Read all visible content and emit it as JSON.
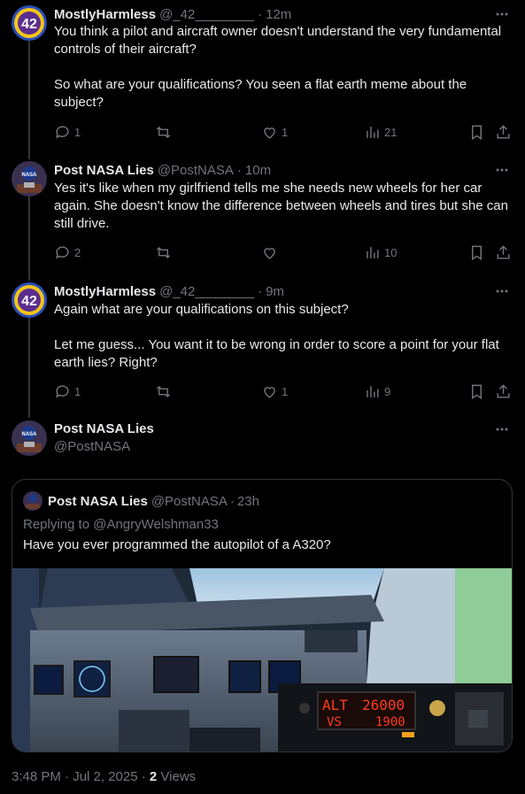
{
  "tweets": [
    {
      "name": "MostlyHarmless",
      "handle": "@_42________",
      "time": "12m",
      "text": "You think a pilot and aircraft owner doesn't understand the very fundamental controls of their aircraft?\n\nSo what are your qualifications? You seen a flat earth meme about the subject?",
      "replies": "1",
      "retweets": "",
      "likes": "1",
      "views": "21",
      "avatar_icon": "42-logo-avatar"
    },
    {
      "name": "Post NASA Lies",
      "handle": "@PostNASA",
      "time": "10m",
      "text": "Yes it's like when my girlfriend tells me she needs new wheels for her car again. She doesn't know the difference between wheels and tires but she can still drive.",
      "replies": "2",
      "retweets": "",
      "likes": "",
      "views": "10",
      "avatar_icon": "nasa-logo-avatar"
    },
    {
      "name": "MostlyHarmless",
      "handle": "@_42________",
      "time": "9m",
      "text": "Again what are your qualifications on this subject?\n\nLet me guess... You want it to be wrong in order to score a point for your flat earth lies? Right?",
      "replies": "1",
      "retweets": "",
      "likes": "1",
      "views": "9",
      "avatar_icon": "42-logo-avatar"
    }
  ],
  "main_tweet": {
    "name": "Post NASA Lies",
    "handle": "@PostNASA",
    "quote": {
      "name": "Post NASA Lies",
      "handle": "@PostNASA",
      "time": "23h",
      "replying_prefix": "Replying to",
      "replying_to": "@AngryWelshman33",
      "text": "Have you ever programmed the autopilot of a A320?",
      "media": {
        "description_icon": "cockpit-photo",
        "display_alt": "ALT",
        "display_alt_value": "26000",
        "display_vs": "VS",
        "display_vs_value": "1900"
      }
    },
    "timestamp": "3:48 PM · Jul 2, 2025 · ",
    "views_count": "2",
    "views_label": " Views"
  },
  "separators": {
    "dot": "·"
  },
  "colors": {
    "background": "#000000",
    "text": "#e7e9ea",
    "secondary": "#71767b",
    "border": "#333639"
  }
}
